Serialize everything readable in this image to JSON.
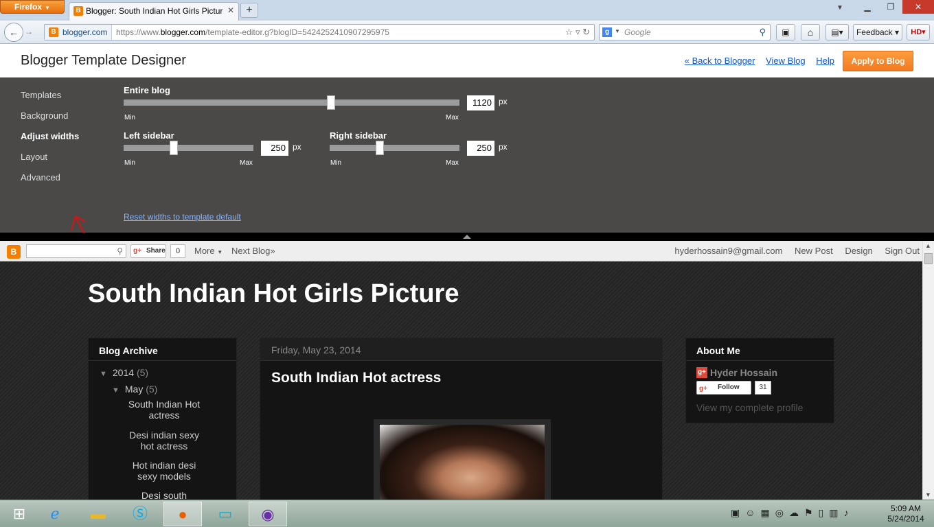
{
  "browser": {
    "menu_button": "Firefox",
    "tab_title": "Blogger: South Indian Hot Girls Picture - ...",
    "site_identity": "blogger.com",
    "url_prefix": "https://www.",
    "url_domain": "blogger.com",
    "url_path": "/template-editor.g?blogID=5424252410907295975",
    "search_placeholder": "Google",
    "feedback_label": "Feedback",
    "hd_label": "HD"
  },
  "designer": {
    "title": "Blogger Template Designer",
    "links": {
      "back": "« Back to Blogger",
      "view_blog": "View Blog",
      "help": "Help"
    },
    "apply_button": "Apply to Blog",
    "nav": [
      "Templates",
      "Background",
      "Adjust widths",
      "Layout",
      "Advanced"
    ],
    "active_nav": "Adjust widths",
    "entire_blog": {
      "label": "Entire blog",
      "value": "1120",
      "unit": "px",
      "min_label": "Min",
      "max_label": "Max",
      "level": 0.62
    },
    "left_sidebar": {
      "label": "Left sidebar",
      "value": "250",
      "unit": "px",
      "min_label": "Min",
      "max_label": "Max",
      "level": 0.38
    },
    "right_sidebar": {
      "label": "Right sidebar",
      "value": "250",
      "unit": "px",
      "min_label": "Min",
      "max_label": "Max",
      "level": 0.38
    },
    "reset_link": "Reset widths to template default"
  },
  "blog_navbar": {
    "share_label": "Share",
    "share_count": "0",
    "more_label": "More",
    "next_blog": "Next Blog»",
    "email": "hyderhossain9@gmail.com",
    "new_post": "New Post",
    "design": "Design",
    "sign_out": "Sign Out"
  },
  "blog": {
    "title": "South Indian Hot Girls Picture",
    "archive": {
      "heading": "Blog Archive",
      "year": "2014",
      "year_count": "(5)",
      "month": "May",
      "month_count": "(5)",
      "posts": [
        "South Indian Hot actress",
        "Desi indian sexy hot actress",
        "Hot indian desi sexy models",
        "Desi south"
      ]
    },
    "post": {
      "date": "Friday, May 23, 2014",
      "title": "South Indian Hot actress"
    },
    "about": {
      "heading": "About Me",
      "name": "Hyder Hossain",
      "follow_label": "Follow",
      "follow_count": "31",
      "profile_link": "View my complete profile"
    }
  },
  "taskbar": {
    "time": "5:09 AM",
    "date": "5/24/2014"
  }
}
